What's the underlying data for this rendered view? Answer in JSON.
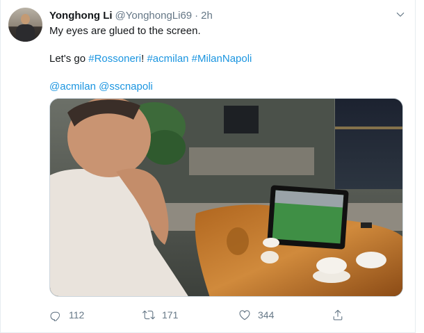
{
  "tweet": {
    "display_name": "Yonghong Li",
    "handle": "@YonghongLi69",
    "separator": "·",
    "time": "2h",
    "line1": "My eyes are glued to the screen.",
    "line2_prefix": "Let's go ",
    "hashtag1": "#Rossoneri",
    "line2_mid": "! ",
    "hashtag2": "#acmilan",
    "space": " ",
    "hashtag3": "#MilanNapoli",
    "mention1": "@acmilan",
    "mention2": "@sscnapoli"
  },
  "actions": {
    "reply_count": "112",
    "retweet_count": "171",
    "like_count": "344"
  },
  "colors": {
    "link": "#1b95e0",
    "muted": "#657786",
    "text": "#14171a"
  },
  "icons": {
    "caret": "chevron-down-icon",
    "reply": "reply-icon",
    "retweet": "retweet-icon",
    "like": "heart-icon",
    "share": "share-icon"
  }
}
